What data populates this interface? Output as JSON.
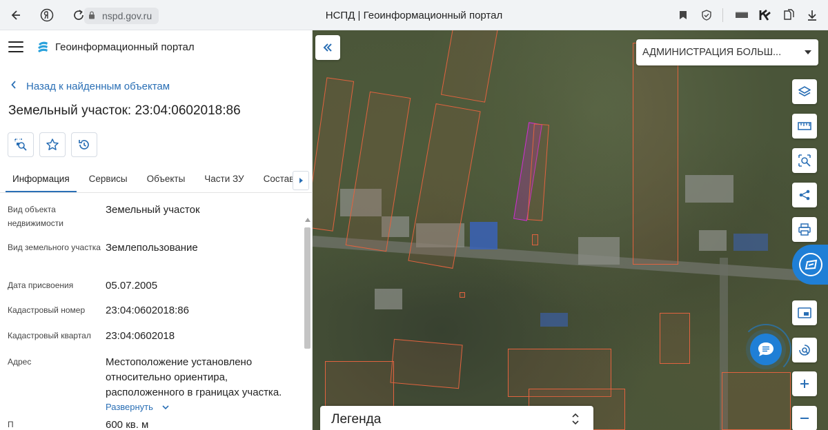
{
  "browser": {
    "url": "nspd.gov.ru",
    "tab_title": "НСПД | Геоинформационный портал"
  },
  "header": {
    "app_title": "Геоинформационный портал"
  },
  "back_link": "Назад к найденным объектам",
  "object_title": "Земельный участок: 23:04:0602018:86",
  "tabs": [
    "Информация",
    "Сервисы",
    "Объекты",
    "Части ЗУ",
    "Состав"
  ],
  "info": {
    "rows": [
      {
        "label": "Вид объекта недвижимости",
        "value": "Земельный участок"
      },
      {
        "label": "Вид земельного участка",
        "value": "Землепользование"
      },
      {
        "label": "Дата присвоения",
        "value": "05.07.2005"
      },
      {
        "label": "Кадастровый номер",
        "value": "23:04:0602018:86"
      },
      {
        "label": "Кадастровый квартал",
        "value": "23:04:0602018"
      },
      {
        "label": "Адрес",
        "value": "Местоположение установлено относительно ориентира, расположенного в границах участка."
      }
    ],
    "expand_label": "Развернуть",
    "partial_label": "П",
    "partial_value": "600 кв. м"
  },
  "map": {
    "admin_select": "АДМИНИСТРАЦИЯ БОЛЬШ...",
    "legend_label": "Легенда",
    "colors": {
      "parcel": "#e2633f",
      "selected_parcel": "#d02fd2",
      "accent": "#2a6fb5",
      "chat": "#1f7fd6"
    }
  }
}
